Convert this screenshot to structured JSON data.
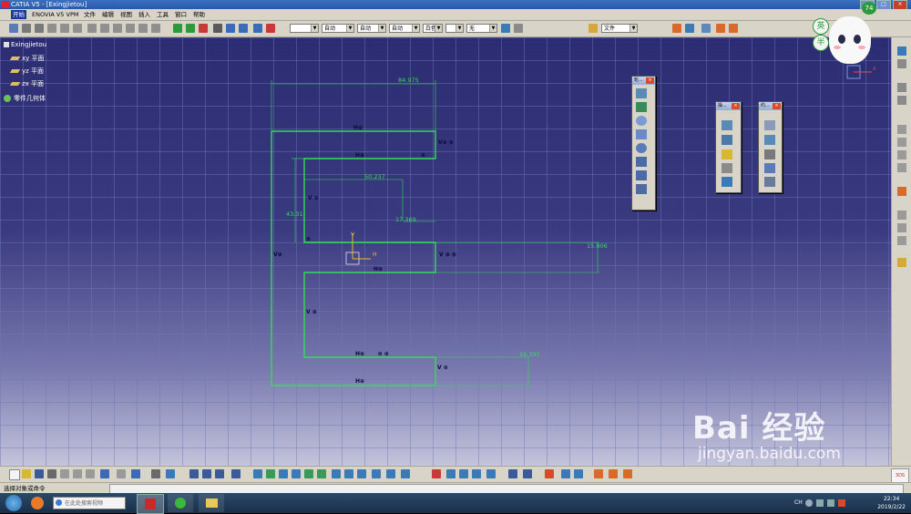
{
  "window": {
    "title": "CATIA V5 - [Exingjietou]"
  },
  "menu": {
    "items": [
      "开始",
      "ENOVIA V5 VPM",
      "文件",
      "编辑",
      "视图",
      "插入",
      "工具",
      "窗口",
      "帮助"
    ]
  },
  "toolbar": {
    "line_style": "",
    "combo_auto1": "自动",
    "combo_auto2": "自动",
    "combo_auto3": "自动",
    "combo_white": "白色",
    "combo_none": "无",
    "file_label": "文件"
  },
  "tree": {
    "root": "Exingjietou",
    "planes": [
      "xy 平面",
      "yz 平面",
      "zx 平面"
    ],
    "body": "零件几何体"
  },
  "sketch": {
    "dims": [
      "84.975",
      "50.237",
      "43.31",
      "17.369",
      "15.906",
      "16.395"
    ],
    "constraint_labels": [
      "H",
      "V"
    ]
  },
  "palettes": [
    {
      "title": "轮..."
    },
    {
      "title": "操..."
    },
    {
      "title": "约..."
    }
  ],
  "statusbar": {
    "prompt": "选择对象或命令"
  },
  "taskbar": {
    "search_placeholder": "在此处搜索视频",
    "clock_time": "22:34",
    "clock_date": "2019/2/22",
    "tray_ch": "CH"
  },
  "watermark": {
    "brand": "Bai 经验",
    "url": "jingyan.baidu.com"
  },
  "badges": {
    "ying": "英",
    "ban": "半",
    "counter": "74"
  },
  "colors": {
    "sketch": "#33dd55",
    "canvas_top": "#2c2c72",
    "canvas_bottom": "#c4c4dc",
    "toolbar": "#d8d4c8"
  }
}
